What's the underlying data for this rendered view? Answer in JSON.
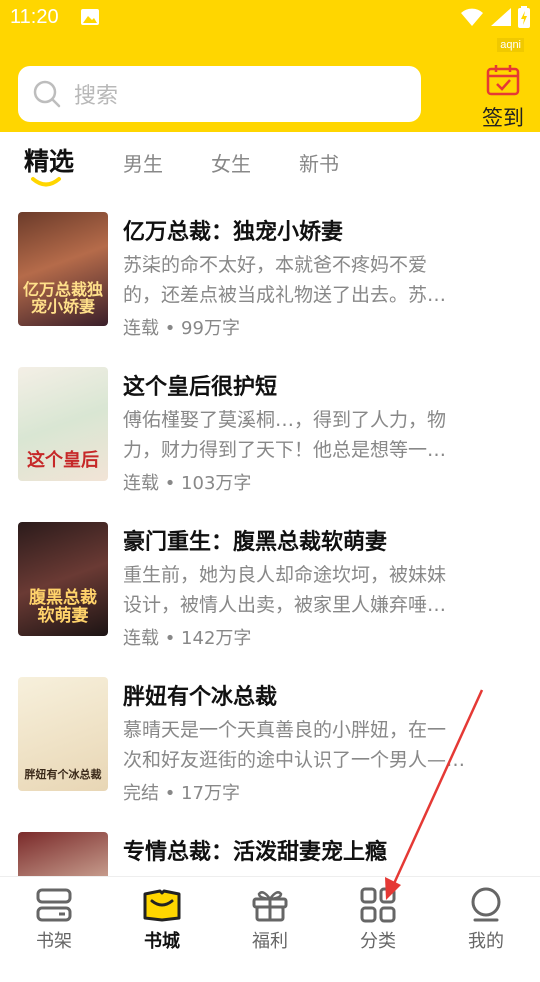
{
  "status_bar": {
    "time": "11:20",
    "watermark": "aqni"
  },
  "search": {
    "placeholder": "搜索"
  },
  "signin": {
    "label": "签到"
  },
  "tabs": [
    {
      "label": "精选",
      "active": true
    },
    {
      "label": "男生",
      "active": false
    },
    {
      "label": "女生",
      "active": false
    },
    {
      "label": "新书",
      "active": false
    }
  ],
  "books": [
    {
      "title": "亿万总裁：独宠小娇妻",
      "desc_line1": "苏柒的命不太好，本就爸不疼妈不爱",
      "desc_line2": "的，还差点被当成礼物送了出去。苏…",
      "meta": "连载 • 99万字",
      "cover_text": "亿万总裁独宠小娇妻"
    },
    {
      "title": "这个皇后很护短",
      "desc_line1": "傅佑槿娶了莫溪桐…，得到了人力，物",
      "desc_line2": "力，财力得到了天下！他总是想等一…",
      "meta": "连载 • 103万字",
      "cover_text": "这个皇后"
    },
    {
      "title": "豪门重生：腹黑总裁软萌妻",
      "desc_line1": "重生前，她为良人却命途坎坷，被妹妹",
      "desc_line2": "设计，被情人出卖，被家里人嫌弃唾…",
      "meta": "连载 • 142万字",
      "cover_text": "腹黑总裁软萌妻"
    },
    {
      "title": "胖妞有个冰总裁",
      "desc_line1": "慕晴天是一个天真善良的小胖妞，在一",
      "desc_line2": "次和好友逛街的途中认识了一个男人—…",
      "meta": "完结 • 17万字",
      "cover_text": "胖妞有个冰总裁"
    },
    {
      "title": "专情总裁：活泼甜妻宠上瘾",
      "desc_line1": "",
      "desc_line2": "",
      "meta": "",
      "cover_text": ""
    }
  ],
  "bottom_nav": [
    {
      "label": "书架",
      "icon": "bookshelf-icon",
      "active": false
    },
    {
      "label": "书城",
      "icon": "bookstore-icon",
      "active": true
    },
    {
      "label": "福利",
      "icon": "gift-icon",
      "active": false
    },
    {
      "label": "分类",
      "icon": "grid-icon",
      "active": false
    },
    {
      "label": "我的",
      "icon": "profile-icon",
      "active": false
    }
  ],
  "colors": {
    "brand_yellow": "#FFD600",
    "annotation_red": "#E53935"
  }
}
